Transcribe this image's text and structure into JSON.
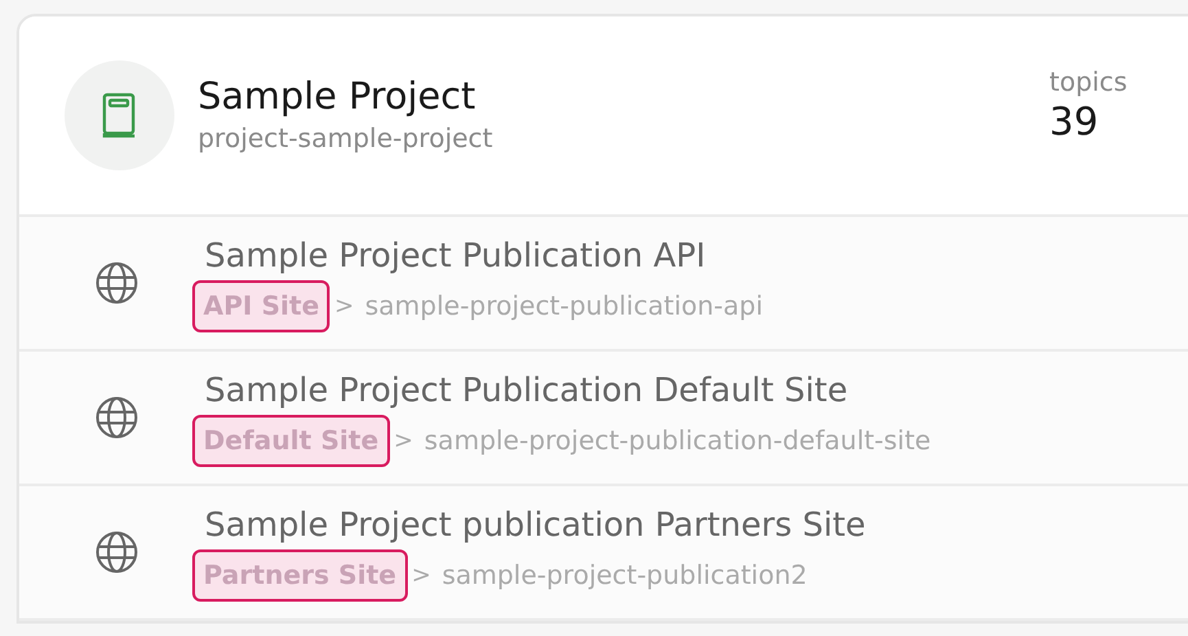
{
  "project": {
    "title": "Sample Project",
    "slug": "project-sample-project",
    "stat_label": "topics",
    "stat_value": "39"
  },
  "sites": [
    {
      "title": "Sample Project Publication API",
      "badge": "API Site",
      "separator": ">",
      "slug": "sample-project-publication-api"
    },
    {
      "title": "Sample Project Publication Default Site",
      "badge": "Default Site",
      "separator": ">",
      "slug": "sample-project-publication-default-site"
    },
    {
      "title": "Sample Project publication Partners Site",
      "badge": "Partners Site",
      "separator": ">",
      "slug": "sample-project-publication2"
    }
  ]
}
